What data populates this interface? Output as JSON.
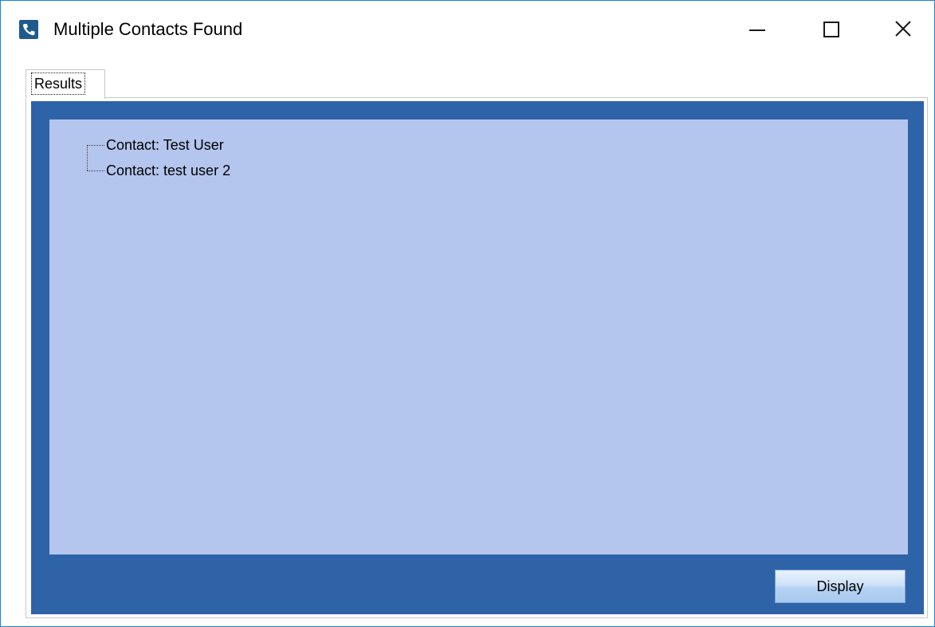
{
  "window": {
    "title": "Multiple Contacts Found",
    "icon": "phone-icon",
    "accent_color": "#1883d7"
  },
  "tabs": [
    {
      "label": "Results",
      "selected": true
    }
  ],
  "results": {
    "background_color": "#b4c5ee",
    "panel_color": "#2e63a8",
    "items": [
      {
        "label": "Contact: Test User"
      },
      {
        "label": "Contact: test user 2"
      }
    ]
  },
  "buttons": {
    "display_label": "Display"
  }
}
